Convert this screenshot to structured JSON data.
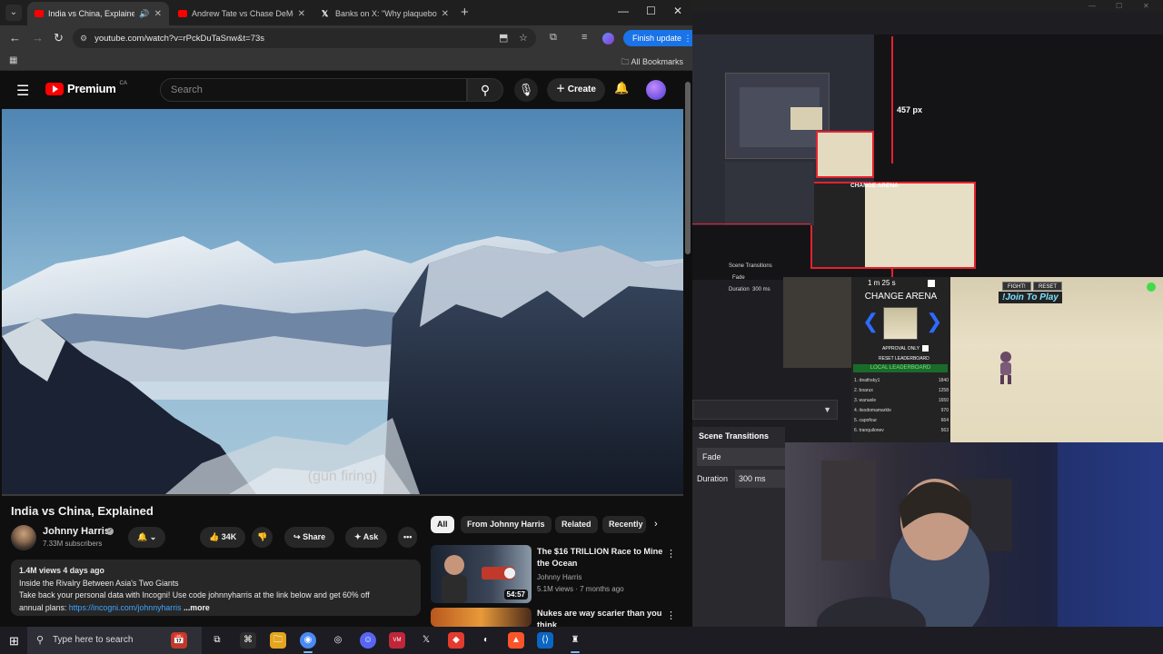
{
  "browser": {
    "tabs": [
      {
        "title": "India vs China, Explained - Yo",
        "active": true,
        "favicon": "youtube-icon"
      },
      {
        "title": "Andrew Tate vs Chase DeMoor",
        "active": false,
        "favicon": "youtube-icon"
      },
      {
        "title": "Banks on X: \"Why plaqueboym",
        "active": false,
        "favicon": "x-icon"
      }
    ],
    "url": "youtube.com/watch?v=rPckDuTaSnw&t=73s",
    "finish_update": "Finish update",
    "all_bookmarks": "All Bookmarks"
  },
  "youtube": {
    "logo_text": "Premium",
    "country": "CA",
    "search_placeholder": "Search",
    "create_label": "Create",
    "video": {
      "caption": "(gun firing)",
      "title": "India vs China, Explained",
      "channel": "Johnny Harris",
      "subscribers": "7.33M subscribers",
      "likes": "34K",
      "share": "Share",
      "ask": "Ask"
    },
    "description": {
      "meta": "1.4M views  4 days ago",
      "line1": "Inside the Rivalry Between Asia's Two Giants",
      "line2": "Take back your personal data with Incogni! Use code johnnyharris at the link below and get 60% off",
      "line3_prefix": "annual plans: ",
      "link": "https://incogni.com/johnnyharris",
      "more": "...more"
    },
    "chips": [
      "All",
      "From Johnny Harris",
      "Related",
      "Recently"
    ],
    "recommendations": [
      {
        "title": "The $16 TRILLION Race to Mine the Ocean",
        "channel": "Johnny Harris",
        "meta": "5.1M views · 7 months ago",
        "duration": "54:57"
      },
      {
        "title": "Nukes are way scarier than you think",
        "channel": "",
        "meta": "",
        "duration": ""
      }
    ]
  },
  "obs": {
    "measure_label": "457 px",
    "scene_transitions": "Scene Transitions",
    "transition": "Fade",
    "duration_label": "Duration",
    "duration_value": "300 ms",
    "sidebar_label": "Scene Transitions",
    "sidebar_fade": "Fade",
    "sidebar_duration": "Duration",
    "sidebar_duration_value": "300 ms",
    "game": {
      "timer": "1 m 25 s",
      "change_arena": "CHANGE ARENA",
      "approval": "APPROVAL ONLY",
      "reset_leaderboard": "RESET LEADERBOARD",
      "local_leaderboard": "LOCAL LEADERBOARD",
      "fight": "FIGHT!",
      "reset": "RESET",
      "join": "!Join To Play",
      "leaderboard": [
        {
          "name": "1. deathsky1",
          "score": "1840"
        },
        {
          "name": "2. boarux",
          "score": "1258"
        },
        {
          "name": "3. wanuele",
          "score": "1650"
        },
        {
          "name": "4. itsodomamarkle",
          "score": "970"
        },
        {
          "name": "5. capofour",
          "score": "664"
        },
        {
          "name": "6. tranquilonev",
          "score": "563"
        }
      ]
    }
  },
  "taskbar": {
    "search_placeholder": "Type here to search"
  }
}
